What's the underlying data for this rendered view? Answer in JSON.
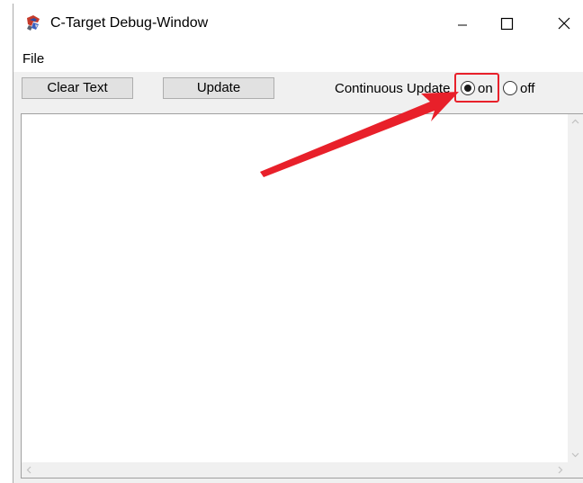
{
  "window": {
    "title": "C-Target Debug-Window",
    "app_icon": "c-target-app-icon",
    "controls": {
      "minimize_icon": "minimize-icon",
      "maximize_icon": "maximize-icon",
      "close_icon": "close-icon"
    }
  },
  "menu": {
    "items": [
      {
        "label": "File"
      }
    ]
  },
  "toolbar": {
    "clear_text_label": "Clear Text",
    "update_label": "Update",
    "continuous_update_label": "Continuous Update",
    "options": [
      {
        "label": "on",
        "selected": true
      },
      {
        "label": "off",
        "selected": false
      }
    ]
  },
  "annotation": {
    "color": "#e8202a",
    "type": "arrow-and-highlight"
  },
  "colors": {
    "window_bg": "#f0f0f0",
    "titlebar_bg": "#ffffff",
    "button_bg": "#e1e1e1",
    "annotation_red": "#e8202a"
  }
}
